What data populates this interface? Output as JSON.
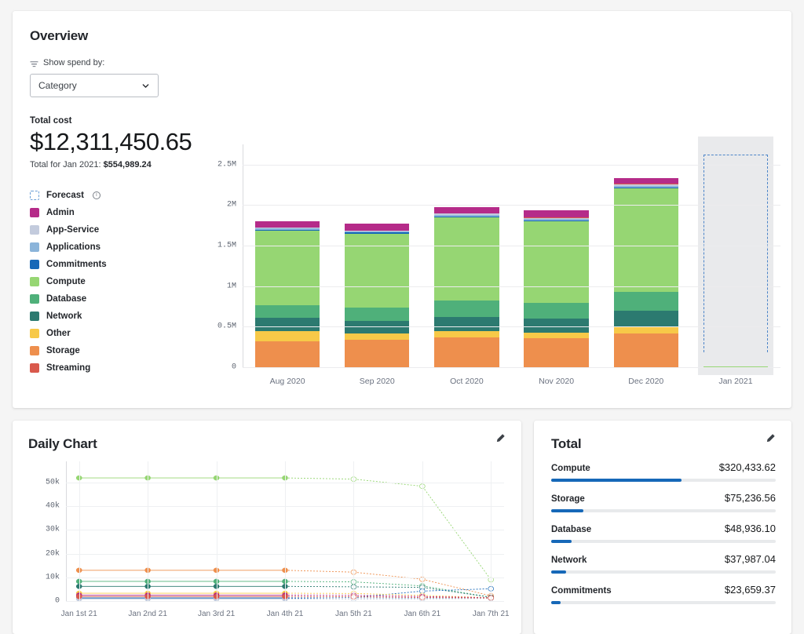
{
  "overview": {
    "title": "Overview",
    "filter_label": "Show spend by:",
    "filter_icon": "funnel-icon",
    "select_value": "Category",
    "select_options": [
      "Category"
    ],
    "chevron_icon": "chevron-down-icon",
    "total_cost_label": "Total cost",
    "total_cost_value": "$12,311,450.65",
    "total_for_prefix": "Total for Jan 2021: ",
    "total_for_value": "$554,989.24",
    "legend": [
      {
        "label": "Forecast",
        "color": "#6b9fd6",
        "forecast": true,
        "info_icon": "info-icon"
      },
      {
        "label": "Admin",
        "color": "#b52b89"
      },
      {
        "label": "App-Service",
        "color": "#c3cbdd"
      },
      {
        "label": "Applications",
        "color": "#8bb4da"
      },
      {
        "label": "Commitments",
        "color": "#1668b8"
      },
      {
        "label": "Compute",
        "color": "#96d673"
      },
      {
        "label": "Database",
        "color": "#4fb07a"
      },
      {
        "label": "Network",
        "color": "#2c7a70"
      },
      {
        "label": "Other",
        "color": "#f7c948"
      },
      {
        "label": "Storage",
        "color": "#ee8f4d"
      },
      {
        "label": "Streaming",
        "color": "#d9594c"
      }
    ]
  },
  "daily": {
    "title": "Daily Chart",
    "edit_icon": "pencil-icon"
  },
  "total": {
    "title": "Total",
    "edit_icon": "pencil-icon",
    "rows": [
      {
        "name": "Compute",
        "amount": "$320,433.62",
        "pct": 58
      },
      {
        "name": "Storage",
        "amount": "$75,236.56",
        "pct": 14.5
      },
      {
        "name": "Database",
        "amount": "$48,936.10",
        "pct": 9
      },
      {
        "name": "Network",
        "amount": "$37,987.04",
        "pct": 6.8
      },
      {
        "name": "Commitments",
        "amount": "$23,659.37",
        "pct": 4.3
      }
    ]
  },
  "chart_data": [
    {
      "type": "bar",
      "title": "Monthly cost by category (stacked)",
      "stacked": true,
      "xlabel": "",
      "ylabel": "",
      "ylim": [
        0,
        2750000
      ],
      "yticks": [
        0,
        500000,
        1000000,
        1500000,
        2000000,
        2500000
      ],
      "ytick_labels": [
        "0",
        "0.5M",
        "1M",
        "1.5M",
        "2M",
        "2.5M"
      ],
      "grid": true,
      "legend_position": "left",
      "categories": [
        "Aug 2020",
        "Sep 2020",
        "Oct 2020",
        "Nov 2020",
        "Dec 2020",
        "Jan 2021"
      ],
      "series": [
        {
          "name": "Storage",
          "color": "#ee8f4d",
          "values": [
            400000,
            425000,
            430000,
            430000,
            455000,
            35000
          ]
        },
        {
          "name": "Other",
          "color": "#f7c948",
          "values": [
            155000,
            90000,
            100000,
            80000,
            90000,
            5000
          ]
        },
        {
          "name": "Network",
          "color": "#2c7a70",
          "values": [
            200000,
            195000,
            205000,
            205000,
            215000,
            14000
          ]
        },
        {
          "name": "Database",
          "color": "#4fb07a",
          "values": [
            185000,
            205000,
            235000,
            235000,
            245000,
            18000
          ]
        },
        {
          "name": "Compute",
          "color": "#96d673",
          "values": [
            1140000,
            1140000,
            1215000,
            1200000,
            1385000,
            94000
          ]
        },
        {
          "name": "Commitments",
          "color": "#1668b8",
          "values": [
            20000,
            20000,
            14000,
            12000,
            20000,
            2500
          ]
        },
        {
          "name": "Applications",
          "color": "#8bb4da",
          "values": [
            14000,
            12000,
            16000,
            14000,
            16000,
            2000
          ]
        },
        {
          "name": "App-Service",
          "color": "#c3cbdd",
          "values": [
            16000,
            14000,
            24000,
            18000,
            24000,
            2000
          ]
        },
        {
          "name": "Streaming",
          "color": "#d9594c",
          "values": [
            6000,
            5000,
            6000,
            5000,
            6000,
            1200
          ]
        },
        {
          "name": "Admin",
          "color": "#b52b89",
          "values": [
            90000,
            100000,
            85000,
            110000,
            80000,
            7000
          ]
        }
      ],
      "forecast_bar": {
        "category": "Jan 2021",
        "top_value": 2620000,
        "note": "dashed outline = forecast"
      }
    },
    {
      "type": "line",
      "title": "Daily Chart",
      "xlabel": "",
      "ylabel": "",
      "ylim": [
        0,
        57000
      ],
      "yticks": [
        0,
        10000,
        20000,
        30000,
        40000,
        50000
      ],
      "ytick_labels": [
        "0",
        "10k",
        "20k",
        "30k",
        "40k",
        "50k"
      ],
      "grid": true,
      "x": [
        "Jan 1st 21",
        "Jan 2nd 21",
        "Jan 3rd 21",
        "Jan 4th 21",
        "Jan 5th 21",
        "Jan 6th 21",
        "Jan 7th 21"
      ],
      "solid_until_index": 3,
      "series": [
        {
          "name": "Compute",
          "color": "#96d673",
          "values": [
            52000,
            52000,
            52000,
            52000,
            51500,
            48500,
            9000
          ]
        },
        {
          "name": "Storage",
          "color": "#ee8f4d",
          "values": [
            13000,
            13000,
            13000,
            13000,
            12200,
            9200,
            2200
          ]
        },
        {
          "name": "Database",
          "color": "#4fb07a",
          "values": [
            8300,
            8300,
            8300,
            8300,
            8100,
            6400,
            1600
          ]
        },
        {
          "name": "Network",
          "color": "#2c7a70",
          "values": [
            6200,
            6200,
            6200,
            6200,
            6000,
            5800,
            1600
          ]
        },
        {
          "name": "Commitments",
          "color": "#1668b8",
          "values": [
            1100,
            1100,
            1100,
            1100,
            1500,
            4200,
            5200
          ]
        },
        {
          "name": "Other",
          "color": "#f7c948",
          "values": [
            3300,
            3300,
            3300,
            3300,
            3200,
            2400,
            1400
          ]
        },
        {
          "name": "Admin",
          "color": "#b52b89",
          "values": [
            2500,
            2500,
            2500,
            2500,
            2400,
            1900,
            1400
          ]
        },
        {
          "name": "Applications",
          "color": "#8bb4da",
          "values": [
            1500,
            1500,
            1500,
            1500,
            1400,
            1200,
            1200
          ]
        },
        {
          "name": "App-Service",
          "color": "#c3cbdd",
          "values": [
            900,
            900,
            900,
            900,
            900,
            900,
            1100
          ]
        },
        {
          "name": "Streaming",
          "color": "#d9594c",
          "values": [
            1900,
            1900,
            1900,
            1900,
            1800,
            1500,
            1300
          ]
        }
      ]
    }
  ]
}
